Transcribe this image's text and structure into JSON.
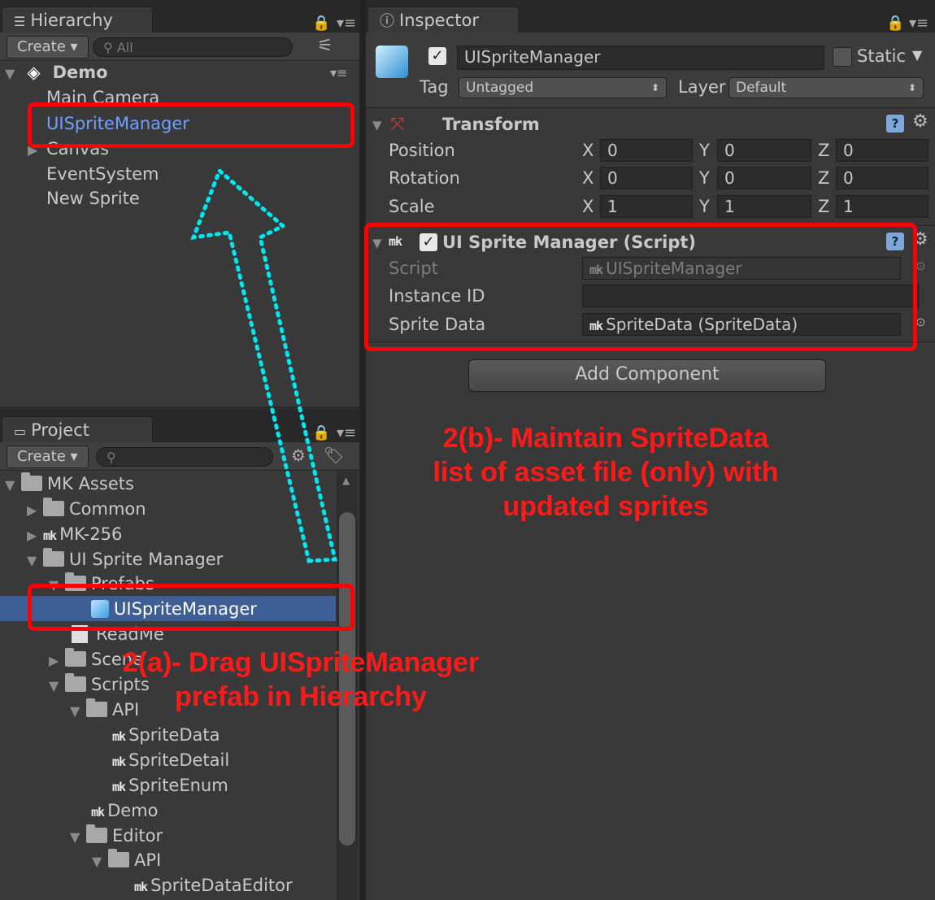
{
  "hierarchy": {
    "tab_label": "Hierarchy",
    "create_label": "Create ▾",
    "search_placeholder": "All",
    "scene_name": "Demo",
    "items": [
      {
        "label": "Main Camera"
      },
      {
        "label": "UISpriteManager"
      },
      {
        "label": "Canvas"
      },
      {
        "label": "EventSystem"
      },
      {
        "label": "New Sprite"
      }
    ]
  },
  "project": {
    "tab_label": "Project",
    "create_label": "Create ▾",
    "tree": [
      {
        "label": "MK Assets"
      },
      {
        "label": "Common"
      },
      {
        "label": "MK-256"
      },
      {
        "label": "UI Sprite Manager"
      },
      {
        "label": "Prefabs"
      },
      {
        "label": "UISpriteManager"
      },
      {
        "label": "ReadMe"
      },
      {
        "label": "Scene"
      },
      {
        "label": "Scripts"
      },
      {
        "label": "API"
      },
      {
        "label": "SpriteData"
      },
      {
        "label": "SpriteDetail"
      },
      {
        "label": "SpriteEnum"
      },
      {
        "label": "Demo"
      },
      {
        "label": "Editor"
      },
      {
        "label": "API"
      },
      {
        "label": "SpriteDataEditor"
      }
    ]
  },
  "inspector": {
    "tab_label": "Inspector",
    "object_name": "UISpriteManager",
    "static_label": "Static",
    "tag_label": "Tag",
    "tag_value": "Untagged",
    "layer_label": "Layer",
    "layer_value": "Default",
    "transform": {
      "title": "Transform",
      "position_label": "Position",
      "rotation_label": "Rotation",
      "scale_label": "Scale",
      "x": "X",
      "y": "Y",
      "z": "Z",
      "position": [
        "0",
        "0",
        "0"
      ],
      "rotation": [
        "0",
        "0",
        "0"
      ],
      "scale": [
        "1",
        "1",
        "1"
      ]
    },
    "script_component": {
      "title": "UI Sprite Manager (Script)",
      "script_label": "Script",
      "script_value": "UISpriteManager",
      "instance_id_label": "Instance ID",
      "instance_id_value": "",
      "sprite_data_label": "Sprite Data",
      "sprite_data_value": "SpriteData (SpriteData)"
    },
    "add_component_label": "Add Component"
  },
  "annotations": {
    "step_a_line1": "2(a)- Drag UISpriteManager",
    "step_a_line2": "prefab in Hierarchy",
    "step_b_line1": "2(b)- Maintain SpriteData",
    "step_b_line2": "list of  asset file (only) with",
    "step_b_line3": "updated sprites"
  },
  "colors": {
    "annotation_red": "#ff0000",
    "arrow_cyan": "#00e5ee",
    "selection_blue": "#3e5f96",
    "highlight_text": "#6fa0ff"
  }
}
